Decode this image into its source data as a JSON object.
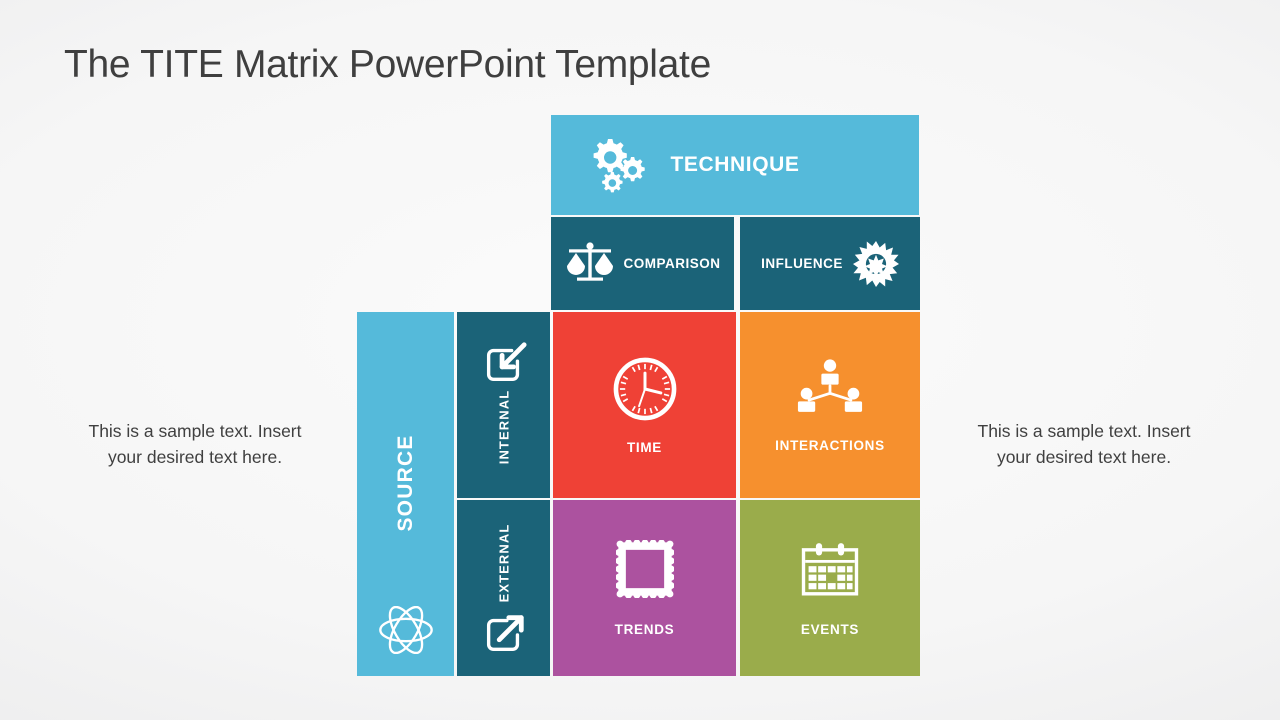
{
  "slide": {
    "title": "The TITE Matrix PowerPoint Template"
  },
  "captions": {
    "left": "This is a sample text. Insert your desired text here.",
    "right": "This is a sample text. Insert your desired text here."
  },
  "matrix": {
    "column_header": {
      "label": "TECHNIQUE",
      "icon": "gears-icon",
      "color": "#55bada"
    },
    "column_subheaders": [
      {
        "label": "COMPARISON",
        "icon": "balance-scale-icon",
        "color": "#1b6378"
      },
      {
        "label": "INFLUENCE",
        "icon": "starburst-icon",
        "color": "#1b6378"
      }
    ],
    "row_header": {
      "label": "SOURCE",
      "icon": "atom-icon",
      "color": "#55bada"
    },
    "row_subheaders": [
      {
        "label": "INTERNAL",
        "icon": "arrow-into-box-icon",
        "color": "#1b6378"
      },
      {
        "label": "EXTERNAL",
        "icon": "arrow-out-of-box-icon",
        "color": "#1b6378"
      }
    ],
    "quadrants": [
      {
        "label": "TIME",
        "icon": "clock-icon",
        "color": "#ef4136"
      },
      {
        "label": "INTERACTIONS",
        "icon": "org-chart-people-icon",
        "color": "#f6902e"
      },
      {
        "label": "TRENDS",
        "icon": "postage-stamp-icon",
        "color": "#ac529f"
      },
      {
        "label": "EVENTS",
        "icon": "calendar-icon",
        "color": "#9aac4b"
      }
    ]
  }
}
